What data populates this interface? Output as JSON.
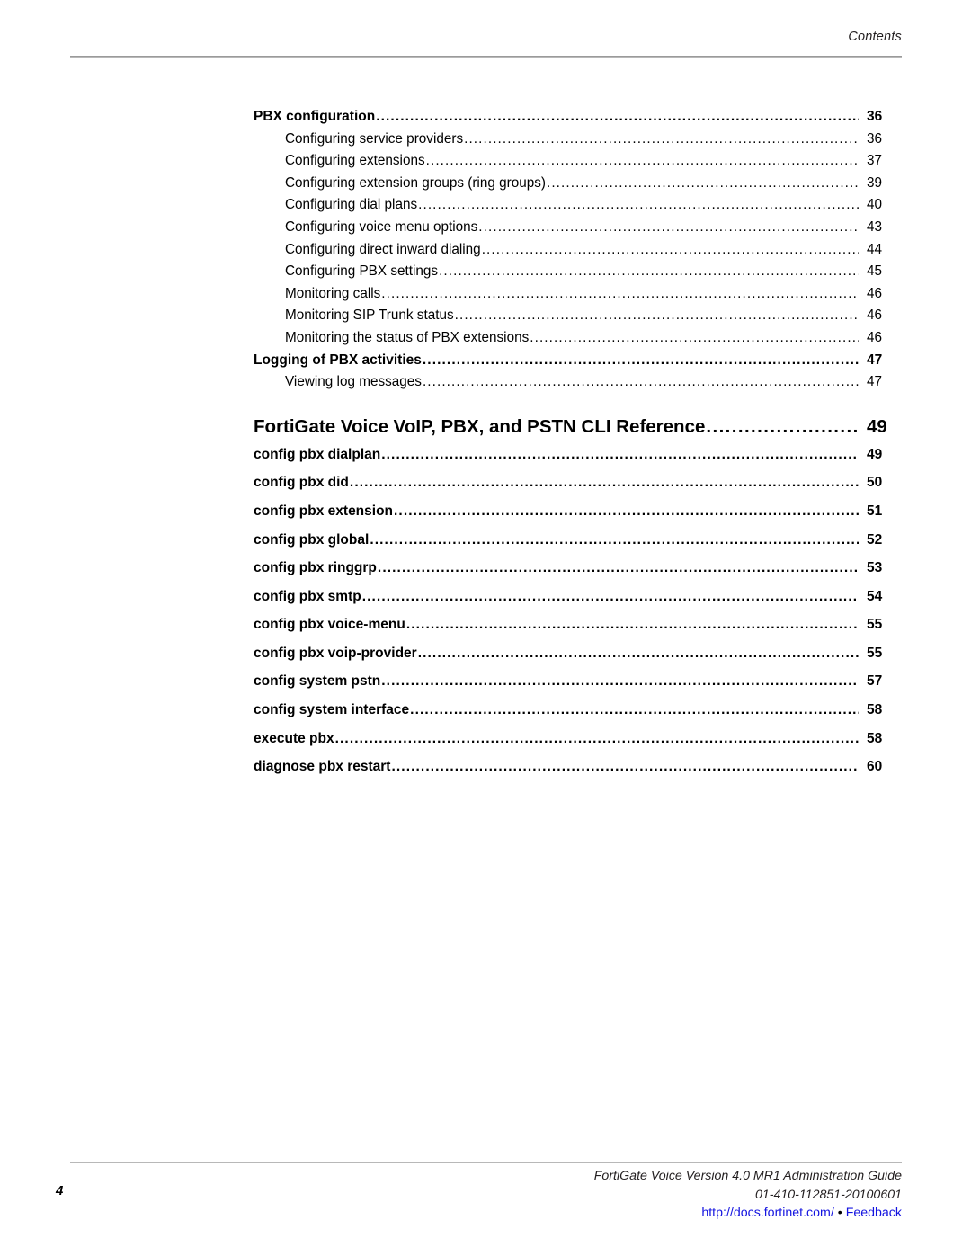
{
  "header": {
    "title": "Contents"
  },
  "toc": {
    "entries": [
      {
        "level": 1,
        "label": "PBX configuration",
        "page": "36"
      },
      {
        "level": 2,
        "label": "Configuring service providers",
        "page": "36"
      },
      {
        "level": 2,
        "label": "Configuring extensions",
        "page": "37"
      },
      {
        "level": 2,
        "label": "Configuring extension groups (ring groups)",
        "page": "39"
      },
      {
        "level": 2,
        "label": "Configuring dial plans",
        "page": "40"
      },
      {
        "level": 2,
        "label": "Configuring voice menu options",
        "page": "43"
      },
      {
        "level": 2,
        "label": "Configuring direct inward dialing",
        "page": "44"
      },
      {
        "level": 2,
        "label": "Configuring PBX settings",
        "page": "45"
      },
      {
        "level": 2,
        "label": "Monitoring calls",
        "page": "46"
      },
      {
        "level": 2,
        "label": "Monitoring SIP Trunk status",
        "page": "46"
      },
      {
        "level": 2,
        "label": "Monitoring the status of PBX extensions",
        "page": "46"
      },
      {
        "level": 1,
        "label": "Logging of PBX activities",
        "page": "47"
      },
      {
        "level": 2,
        "label": "Viewing log messages",
        "page": "47"
      },
      {
        "level": 0,
        "label": "FortiGate Voice VoIP, PBX, and PSTN CLI Reference",
        "page": "49"
      },
      {
        "level": 3,
        "label": "config pbx dialplan",
        "page": "49"
      },
      {
        "level": 3,
        "label": "config pbx did",
        "page": "50"
      },
      {
        "level": 3,
        "label": "config pbx extension",
        "page": "51"
      },
      {
        "level": 3,
        "label": "config pbx global",
        "page": "52"
      },
      {
        "level": 3,
        "label": "config pbx ringgrp",
        "page": "53"
      },
      {
        "level": 3,
        "label": "config pbx smtp",
        "page": "54"
      },
      {
        "level": 3,
        "label": "config pbx voice-menu",
        "page": "55"
      },
      {
        "level": 3,
        "label": "config pbx voip-provider",
        "page": "55"
      },
      {
        "level": 3,
        "label": "config system pstn",
        "page": "57"
      },
      {
        "level": 3,
        "label": "config system interface",
        "page": "58"
      },
      {
        "level": 3,
        "label": "execute pbx",
        "page": "58"
      },
      {
        "level": 3,
        "label": "diagnose pbx restart",
        "page": "60"
      }
    ]
  },
  "footer": {
    "page_number": "4",
    "doc_title": "FortiGate Voice Version 4.0 MR1 Administration Guide",
    "doc_id": "01-410-112851-20100601",
    "url_text": "http://docs.fortinet.com/",
    "separator": "•",
    "feedback_text": "Feedback",
    "link_color": "#1414e0"
  }
}
